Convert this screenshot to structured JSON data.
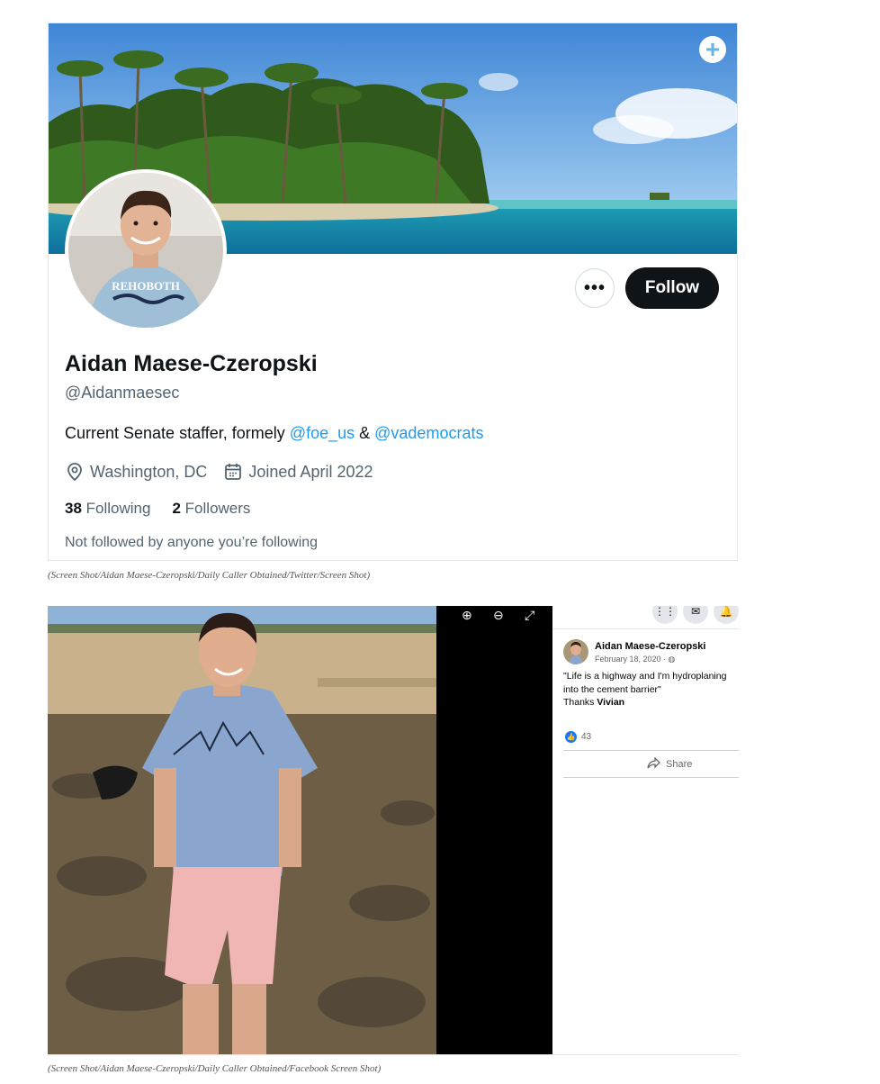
{
  "twitter": {
    "banner_action_icon": "plus-circle-icon",
    "more_label": "•••",
    "follow_label": "Follow",
    "name": "Aidan Maese-Czeropski",
    "handle": "@Aidanmaesec",
    "bio_prefix": "Current Senate staffer, formely ",
    "bio_mention_1": "@foe_us",
    "bio_amp": " & ",
    "bio_mention_2": "@vademocrats",
    "location": "Washington, DC",
    "joined": "Joined April 2022",
    "following_count": "38",
    "following_label": "Following",
    "followers_count": "2",
    "followers_label": "Followers",
    "not_followed": "Not followed by anyone you’re following",
    "link_color": "#1d9bf0"
  },
  "caption_1": "(Screen Shot/Aidan Maese-Czeropski/Daily Caller Obtained/Twitter/Screen Shot)",
  "facebook": {
    "name": "Aidan Maese-Czeropski",
    "date": "February 18, 2020 · ",
    "globe_icon": "◍",
    "post_line_1": "\"Life is a highway and I'm hydroplaning",
    "post_line_2": "into the cement barrier\"",
    "thanks": "Thanks ",
    "thanks_name": "Vivian",
    "like_count": "43",
    "share_label": "Share",
    "zoom_in_icon": "⊕",
    "zoom_out_icon": "⊖",
    "fullscreen_icon": "⤢",
    "like_color": "#1877f2"
  },
  "caption_2": "(Screen Shot/Aidan Maese-Czeropski/Daily Caller Obtained/Facebook Screen Shot)"
}
